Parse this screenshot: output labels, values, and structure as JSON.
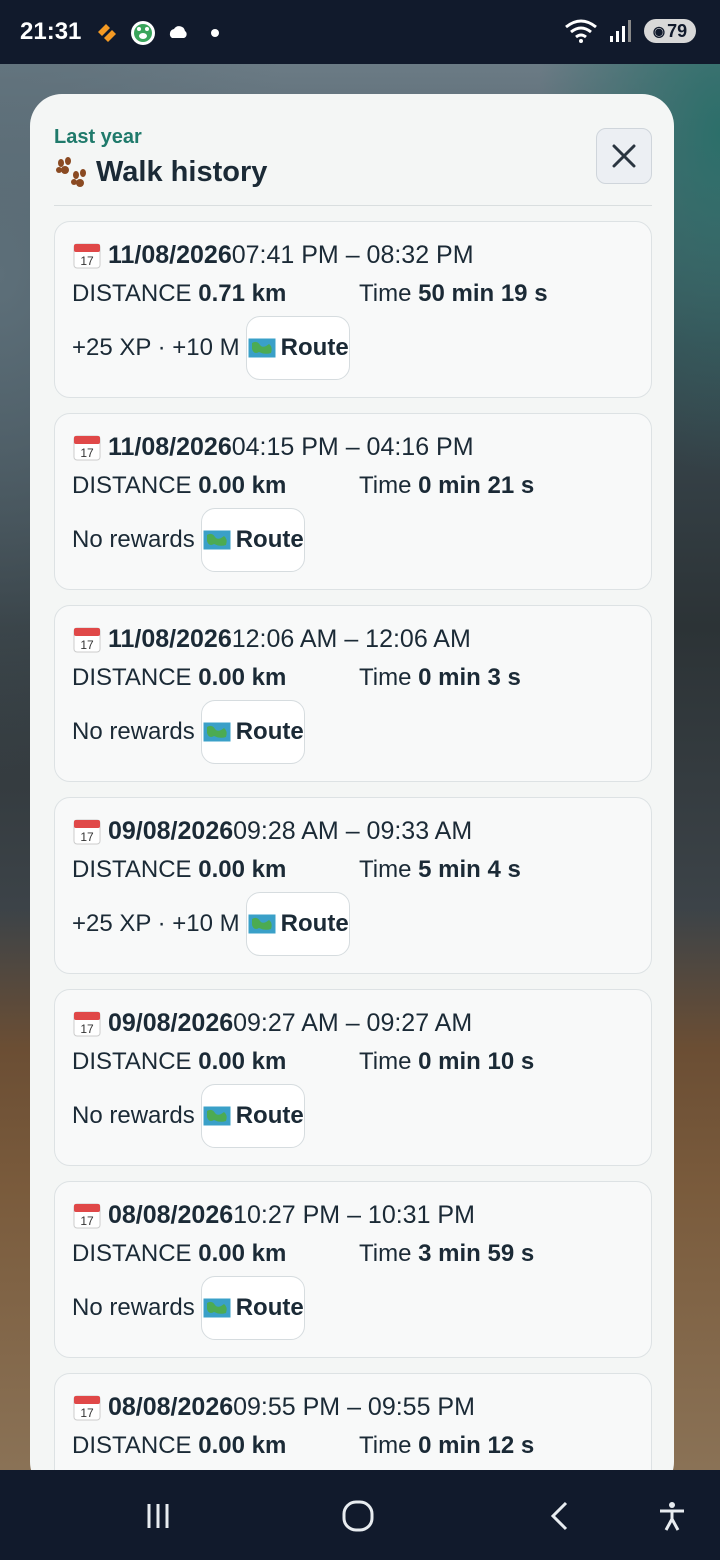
{
  "status_bar": {
    "time": "21:31",
    "battery": "79",
    "icons_left": [
      "app-icon",
      "paw-app-icon",
      "cloud-icon",
      "dot-icon"
    ],
    "icons_right": [
      "wifi-icon",
      "signal-icon",
      "battery-icon"
    ]
  },
  "modal": {
    "subtitle": "Last year",
    "title": "Walk history",
    "close_label": "×"
  },
  "walks": [
    {
      "date": "11/08/2026",
      "time_range": "07:41 PM – 08:32 PM",
      "distance_label": "DISTANCE",
      "distance": "0.71 km",
      "time_label": "Time",
      "duration": "50 min 19 s",
      "rewards": "+25 XP · +10 M",
      "route_label": "Route"
    },
    {
      "date": "11/08/2026",
      "time_range": "04:15 PM – 04:16 PM",
      "distance_label": "DISTANCE",
      "distance": "0.00 km",
      "time_label": "Time",
      "duration": "0 min 21 s",
      "rewards": "No rewards",
      "route_label": "Route"
    },
    {
      "date": "11/08/2026",
      "time_range": "12:06 AM – 12:06 AM",
      "distance_label": "DISTANCE",
      "distance": "0.00 km",
      "time_label": "Time",
      "duration": "0 min 3 s",
      "rewards": "No rewards",
      "route_label": "Route"
    },
    {
      "date": "09/08/2026",
      "time_range": "09:28 AM – 09:33 AM",
      "distance_label": "DISTANCE",
      "distance": "0.00 km",
      "time_label": "Time",
      "duration": "5 min 4 s",
      "rewards": "+25 XP · +10 M",
      "route_label": "Route"
    },
    {
      "date": "09/08/2026",
      "time_range": "09:27 AM – 09:27 AM",
      "distance_label": "DISTANCE",
      "distance": "0.00 km",
      "time_label": "Time",
      "duration": "0 min 10 s",
      "rewards": "No rewards",
      "route_label": "Route"
    },
    {
      "date": "08/08/2026",
      "time_range": "10:27 PM – 10:31 PM",
      "distance_label": "DISTANCE",
      "distance": "0.00 km",
      "time_label": "Time",
      "duration": "3 min 59 s",
      "rewards": "No rewards",
      "route_label": "Route"
    },
    {
      "date": "08/08/2026",
      "time_range": "09:55 PM – 09:55 PM",
      "distance_label": "DISTANCE",
      "distance": "0.00 km",
      "time_label": "Time",
      "duration": "0 min 12 s",
      "rewards": "",
      "route_label": ""
    }
  ],
  "nav": {
    "icons": [
      "recent-apps-icon",
      "home-icon",
      "back-icon",
      "accessibility-icon"
    ]
  },
  "colors": {
    "accent": "#1f7a6b",
    "text": "#1b2a36",
    "card_bg": "#f8f9f9",
    "modal_bg": "#f4f6f5"
  }
}
